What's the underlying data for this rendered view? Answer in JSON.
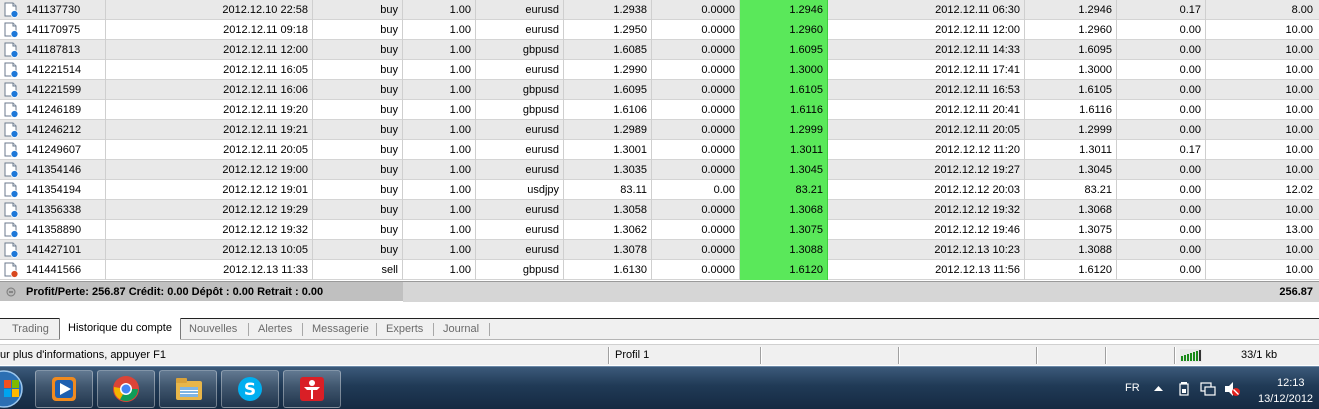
{
  "trades": [
    {
      "ticket": "141137730",
      "open_time": "2012.12.10 22:58",
      "type": "buy",
      "size": "1.00",
      "item": "eurusd",
      "price": "1.2938",
      "sl": "0.0000",
      "tp": "1.2946",
      "close_time": "2012.12.11 06:30",
      "close_price": "1.2946",
      "swap": "0.17",
      "profit": "8.00"
    },
    {
      "ticket": "141170975",
      "open_time": "2012.12.11 09:18",
      "type": "buy",
      "size": "1.00",
      "item": "eurusd",
      "price": "1.2950",
      "sl": "0.0000",
      "tp": "1.2960",
      "close_time": "2012.12.11 12:00",
      "close_price": "1.2960",
      "swap": "0.00",
      "profit": "10.00"
    },
    {
      "ticket": "141187813",
      "open_time": "2012.12.11 12:00",
      "type": "buy",
      "size": "1.00",
      "item": "gbpusd",
      "price": "1.6085",
      "sl": "0.0000",
      "tp": "1.6095",
      "close_time": "2012.12.11 14:33",
      "close_price": "1.6095",
      "swap": "0.00",
      "profit": "10.00"
    },
    {
      "ticket": "141221514",
      "open_time": "2012.12.11 16:05",
      "type": "buy",
      "size": "1.00",
      "item": "eurusd",
      "price": "1.2990",
      "sl": "0.0000",
      "tp": "1.3000",
      "close_time": "2012.12.11 17:41",
      "close_price": "1.3000",
      "swap": "0.00",
      "profit": "10.00"
    },
    {
      "ticket": "141221599",
      "open_time": "2012.12.11 16:06",
      "type": "buy",
      "size": "1.00",
      "item": "gbpusd",
      "price": "1.6095",
      "sl": "0.0000",
      "tp": "1.6105",
      "close_time": "2012.12.11 16:53",
      "close_price": "1.6105",
      "swap": "0.00",
      "profit": "10.00"
    },
    {
      "ticket": "141246189",
      "open_time": "2012.12.11 19:20",
      "type": "buy",
      "size": "1.00",
      "item": "gbpusd",
      "price": "1.6106",
      "sl": "0.0000",
      "tp": "1.6116",
      "close_time": "2012.12.11 20:41",
      "close_price": "1.6116",
      "swap": "0.00",
      "profit": "10.00"
    },
    {
      "ticket": "141246212",
      "open_time": "2012.12.11 19:21",
      "type": "buy",
      "size": "1.00",
      "item": "eurusd",
      "price": "1.2989",
      "sl": "0.0000",
      "tp": "1.2999",
      "close_time": "2012.12.11 20:05",
      "close_price": "1.2999",
      "swap": "0.00",
      "profit": "10.00"
    },
    {
      "ticket": "141249607",
      "open_time": "2012.12.11 20:05",
      "type": "buy",
      "size": "1.00",
      "item": "eurusd",
      "price": "1.3001",
      "sl": "0.0000",
      "tp": "1.3011",
      "close_time": "2012.12.12 11:20",
      "close_price": "1.3011",
      "swap": "0.17",
      "profit": "10.00"
    },
    {
      "ticket": "141354146",
      "open_time": "2012.12.12 19:00",
      "type": "buy",
      "size": "1.00",
      "item": "eurusd",
      "price": "1.3035",
      "sl": "0.0000",
      "tp": "1.3045",
      "close_time": "2012.12.12 19:27",
      "close_price": "1.3045",
      "swap": "0.00",
      "profit": "10.00"
    },
    {
      "ticket": "141354194",
      "open_time": "2012.12.12 19:01",
      "type": "buy",
      "size": "1.00",
      "item": "usdjpy",
      "price": "83.11",
      "sl": "0.00",
      "tp": "83.21",
      "close_time": "2012.12.12 20:03",
      "close_price": "83.21",
      "swap": "0.00",
      "profit": "12.02"
    },
    {
      "ticket": "141356338",
      "open_time": "2012.12.12 19:29",
      "type": "buy",
      "size": "1.00",
      "item": "eurusd",
      "price": "1.3058",
      "sl": "0.0000",
      "tp": "1.3068",
      "close_time": "2012.12.12 19:32",
      "close_price": "1.3068",
      "swap": "0.00",
      "profit": "10.00"
    },
    {
      "ticket": "141358890",
      "open_time": "2012.12.12 19:32",
      "type": "buy",
      "size": "1.00",
      "item": "eurusd",
      "price": "1.3062",
      "sl": "0.0000",
      "tp": "1.3075",
      "close_time": "2012.12.12 19:46",
      "close_price": "1.3075",
      "swap": "0.00",
      "profit": "13.00"
    },
    {
      "ticket": "141427101",
      "open_time": "2012.12.13 10:05",
      "type": "buy",
      "size": "1.00",
      "item": "eurusd",
      "price": "1.3078",
      "sl": "0.0000",
      "tp": "1.3088",
      "close_time": "2012.12.13 10:23",
      "close_price": "1.3088",
      "swap": "0.00",
      "profit": "10.00"
    },
    {
      "ticket": "141441566",
      "open_time": "2012.12.13 11:33",
      "type": "sell",
      "size": "1.00",
      "item": "gbpusd",
      "price": "1.6130",
      "sl": "0.0000",
      "tp": "1.6120",
      "close_time": "2012.12.13 11:56",
      "close_price": "1.6120",
      "swap": "0.00",
      "profit": "10.00"
    }
  ],
  "summary": {
    "text": "Profit/Perte: 256.87  Crédit: 0.00  Dépôt : 0.00  Retrait : 0.00",
    "total_profit": "256.87"
  },
  "colors": {
    "tp_highlight": "#5ae85a",
    "buy_icon": "#1e78d8",
    "sell_icon": "#d8481e"
  },
  "tabs": [
    {
      "label": "Trading",
      "active": false
    },
    {
      "label": "Historique du compte",
      "active": true
    },
    {
      "label": "Nouvelles",
      "active": false
    },
    {
      "label": "Alertes",
      "active": false
    },
    {
      "label": "Messagerie",
      "active": false
    },
    {
      "label": "Experts",
      "active": false
    },
    {
      "label": "Journal",
      "active": false
    }
  ],
  "statusbar": {
    "help_text": "ur plus d'informations, appuyer F1",
    "profile": "Profil 1",
    "traffic": "33/1 kb"
  },
  "taskbar": {
    "apps": [
      "windows-media-player-icon",
      "chrome-icon",
      "file-explorer-icon",
      "skype-icon",
      "trading-terminal-icon"
    ],
    "language": "FR",
    "time": "12:13",
    "date": "13/12/2012"
  }
}
